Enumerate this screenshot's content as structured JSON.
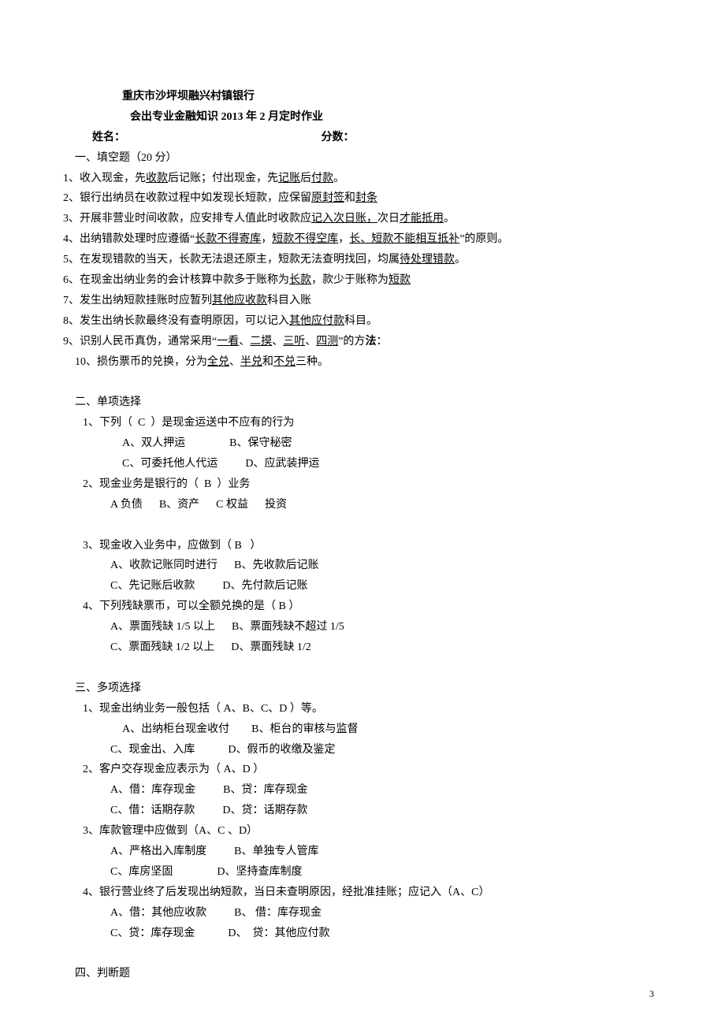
{
  "header": {
    "org": "重庆市沙坪坝融兴村镇银行",
    "title": "会出专业金融知识 2013 年 2 月定时作业",
    "name_label": "姓名：",
    "score_label": "分数："
  },
  "section1": {
    "heading": "一、填空题（20 分）",
    "q1_a": "1、收入现金，先",
    "q1_u1": "收款",
    "q1_b": "后记账；付出现金，先",
    "q1_u2": "记账",
    "q1_c": "后",
    "q1_u3": "付款",
    "q1_d": "。",
    "q2_a": "2、银行出纳员在收款过程中如发现长短款，应保留",
    "q2_u1": "原封签",
    "q2_b": "和",
    "q2_u2": "封条",
    "q3_a": "3、开展非营业时间收款，应安排专人值此时收款应",
    "q3_u1": "记入次日账，",
    "q3_b": "次日",
    "q3_u2": "才能抵用",
    "q3_c": "。",
    "q4_a": "4、出纳错款处理时应遵循“",
    "q4_u1": "长款不得寄库",
    "q4_b": "，",
    "q4_u2": "短款不得空库",
    "q4_c": "，",
    "q4_u3": "长、短款不能相互抵补",
    "q4_d": "”的原则。",
    "q5_a": "5、在发现错款的当天，长款无法退还原主，短款无法查明找回，均属",
    "q5_u1": "待处理错款",
    "q5_b": "。",
    "q6_a": "6、在现金出纳业务的会计核算中款多于账称为",
    "q6_u1": "长款",
    "q6_b": "，款少于账称为",
    "q6_u2": "短款",
    "q7_a": "7、发生出纳短款挂账时应暂列",
    "q7_u1": "其他应收款",
    "q7_b": "科目入账",
    "q8_a": "8、发生出纳长款最终没有查明原因，可以记入",
    "q8_u1": "其他应付款",
    "q8_b": "科目。",
    "q9_a": "9、识别人民币真伪，通常采用“",
    "q9_u1": "一看",
    "q9_s1": "、",
    "q9_u2": "二摸",
    "q9_s2": "、",
    "q9_u3": "三听",
    "q9_s3": "、",
    "q9_u4": "四测",
    "q9_b": "”的方",
    "q9_bold": "法",
    "q9_c": "：",
    "q10_a": "10、损伤票币的兑换，分为",
    "q10_u1": "全兑",
    "q10_s1": "、",
    "q10_u2": "半兑",
    "q10_b": "和",
    "q10_u3": "不兑",
    "q10_c": "三种。"
  },
  "section2": {
    "heading": "二、单项选择",
    "q1": "1、下列（  C  ）是现金运送中不应有的行为",
    "q1_ab": "A、双人押运                B、保守秘密",
    "q1_cd": "C、可委托他人代运          D、应武装押运",
    "q2": "2、现金业务是银行的（  B  ）业务",
    "q2_opts": "A 负债      B、资产      C 权益      投资",
    "q3": "3、现金收入业务中，应做到（ B   ）",
    "q3_ab": "A、收款记账同时进行      B、先收款后记账",
    "q3_cd": "C、先记账后收款          D、先付款后记账",
    "q4": "4、下列残缺票币，可以全额兑换的是（ B ）",
    "q4_ab": "A、票面残缺 1/5 以上      B、票面残缺不超过 1/5",
    "q4_cd": "C、票面残缺 1/2 以上      D、票面残缺 1/2"
  },
  "section3": {
    "heading": "三、多项选择",
    "q1": "1、现金出纳业务一般包括（ A、B、C、D ）等。",
    "q1_ab": "A、出纳柜台现金收付        B、柜台的审核与监督",
    "q1_cd": "C、现金出、入库            D、假币的收缴及鉴定",
    "q2": "2、客户交存现金应表示为（ A、D ）",
    "q2_ab": "A、借：库存现金          B、贷：库存现金",
    "q2_cd": "C、借：话期存款          D、贷：话期存款",
    "q3": "3、库款管理中应做到（A、C 、D）",
    "q3_ab": "A、严格出入库制度          B、单独专人管库",
    "q3_cd": "C、库房坚固                D、坚持查库制度",
    "q4": "4、银行营业终了后发现出纳短款，当日未查明原因，经批准挂账；应记入（A、C）",
    "q4_ab": "A、借：其他应收款          B、 借：库存现金",
    "q4_cd": "C、贷：库存现金            D、  贷：其他应付款"
  },
  "section4": {
    "heading": "四、判断题"
  },
  "page_num": "3"
}
